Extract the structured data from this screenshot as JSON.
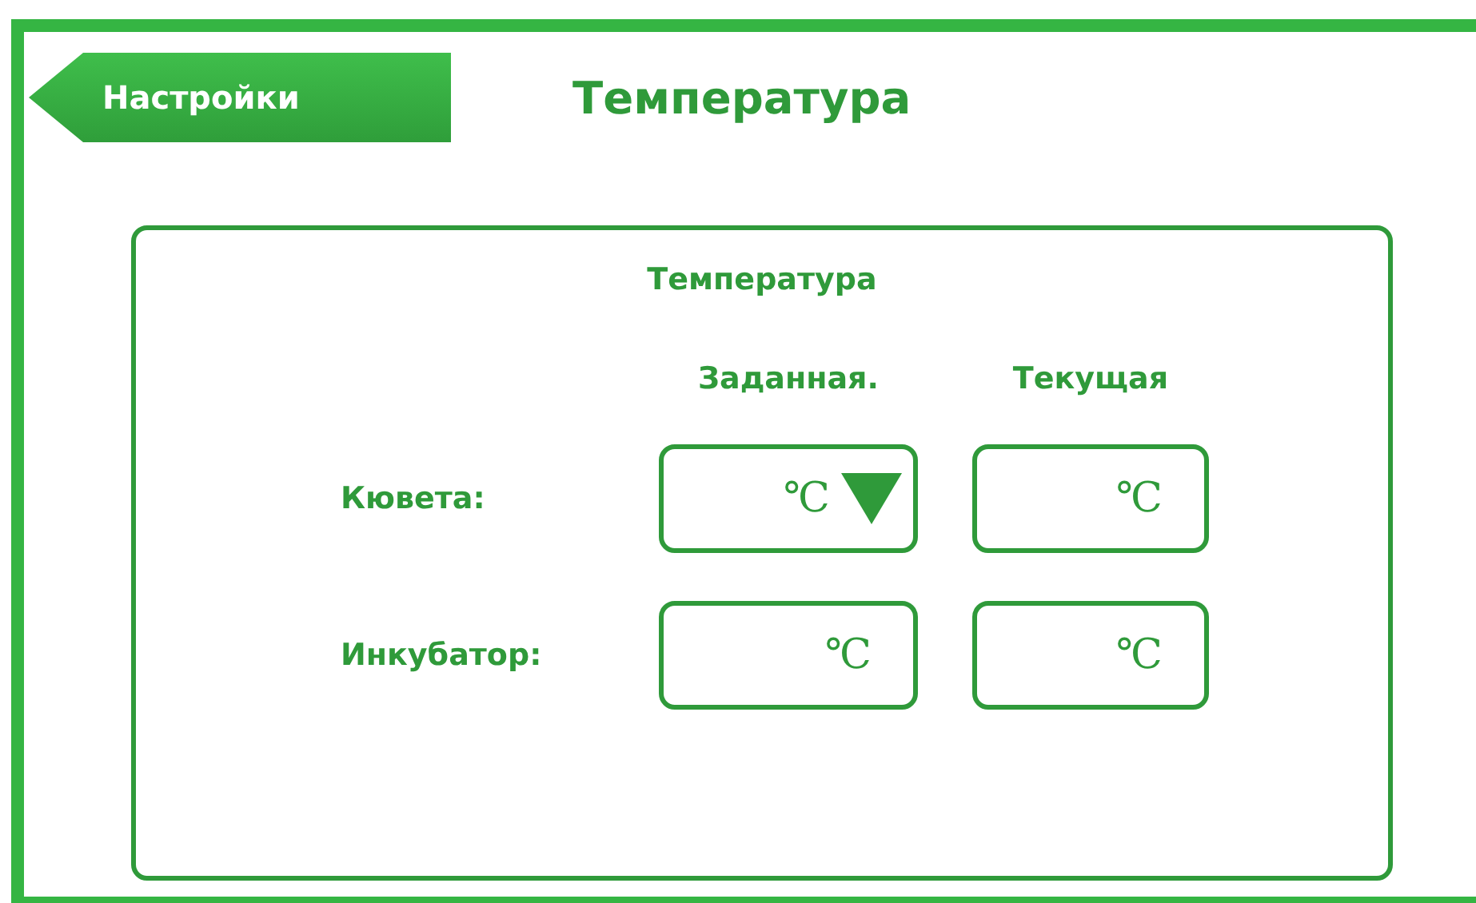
{
  "back_button": {
    "label": "Настройки"
  },
  "page_title": "Температура",
  "panel": {
    "title": "Температура",
    "columns": [
      "Заданная.",
      "Текущая"
    ],
    "rows": [
      {
        "label": "Кювета:",
        "fields": [
          {
            "kind": "dropdown",
            "unit": "℃"
          },
          {
            "kind": "field",
            "unit": "℃"
          }
        ]
      },
      {
        "label": "Инкубатор:",
        "fields": [
          {
            "kind": "field",
            "unit": "℃"
          },
          {
            "kind": "field",
            "unit": "℃"
          }
        ]
      }
    ]
  }
}
